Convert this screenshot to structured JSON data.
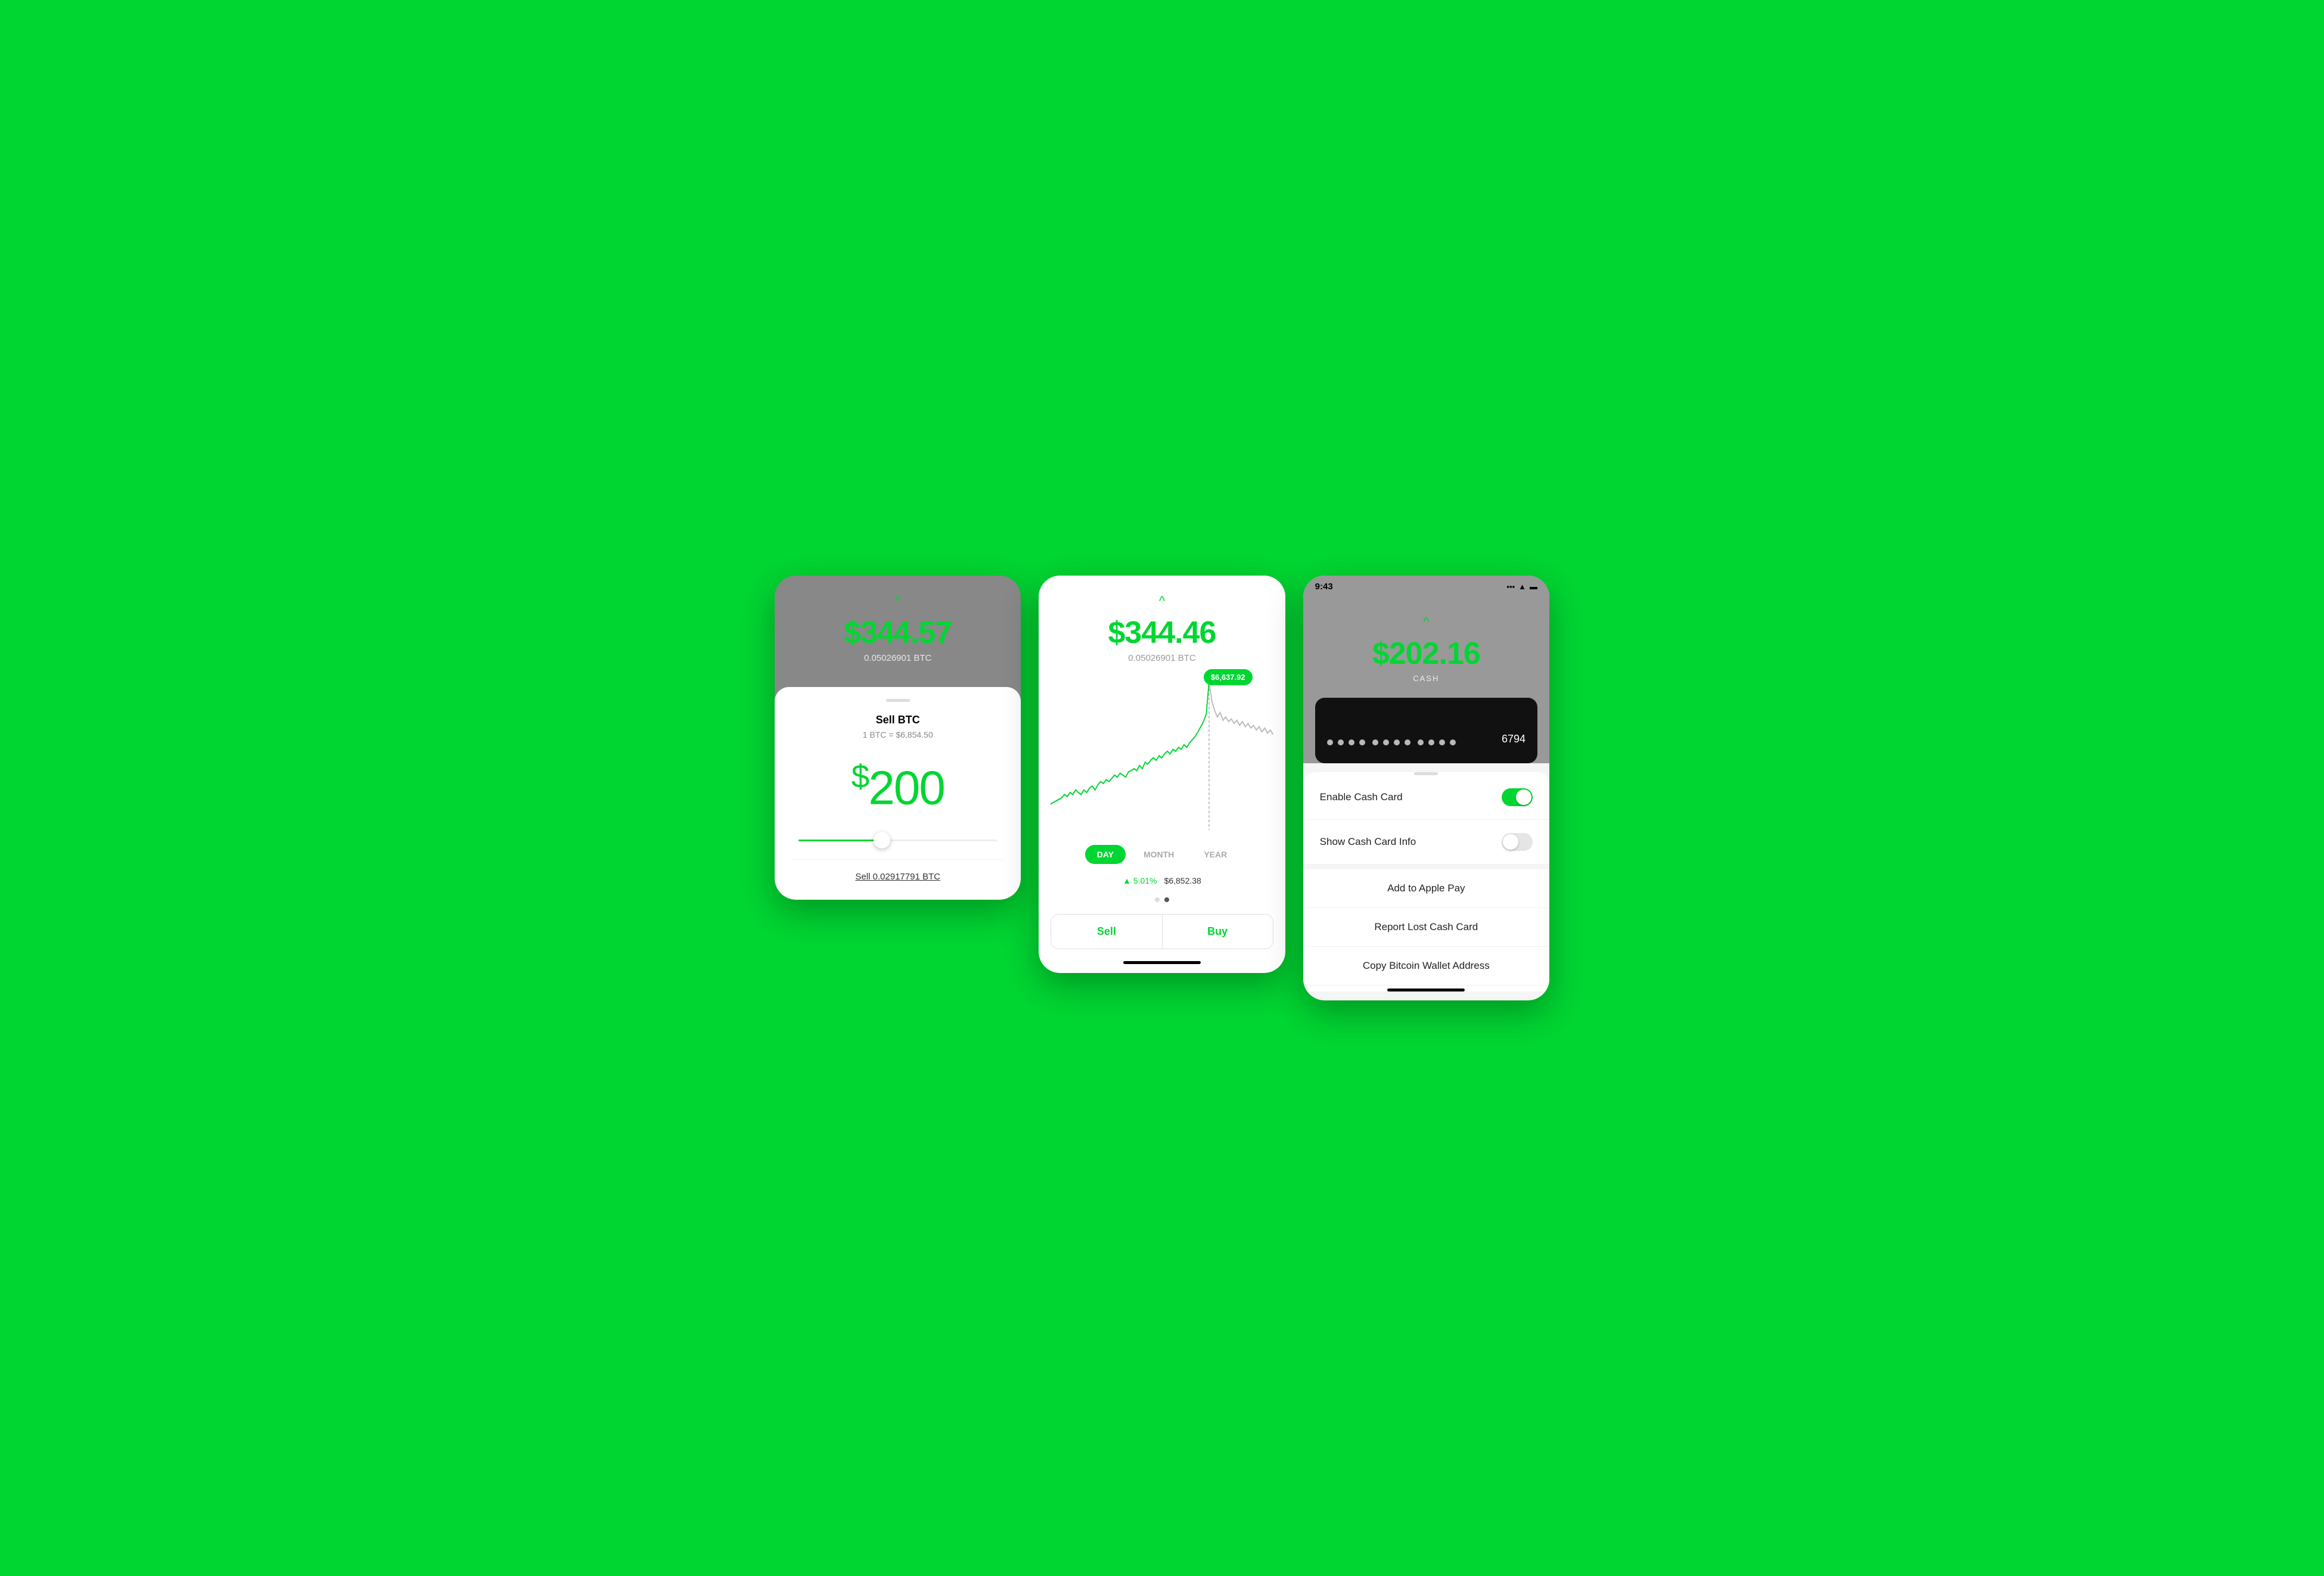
{
  "screen1": {
    "chevron": "^",
    "btc_value": "$344.57",
    "btc_amount": "0.05026901 BTC",
    "handle": "",
    "sell_title": "Sell BTC",
    "sell_rate": "1 BTC = $6,854.50",
    "sell_amount_symbol": "$",
    "sell_amount_value": "200",
    "slider_fill_pct": "42",
    "sell_label": "Sell 0.02917791 BTC"
  },
  "screen2": {
    "chevron": "^",
    "btc_value": "$344.46",
    "btc_amount": "0.05026901 BTC",
    "tooltip_value": "$6,637.92",
    "time_tabs": [
      "DAY",
      "MONTH",
      "YEAR"
    ],
    "active_tab": "DAY",
    "stat_change": "▲ 5.01%",
    "stat_price": "$6,852.38",
    "sell_btn": "Sell",
    "buy_btn": "Buy"
  },
  "screen3": {
    "status_time": "9:43",
    "status_arrow": "✈",
    "chevron": "^",
    "cash_value": "$202.16",
    "cash_label": "CASH",
    "card_last4": "6794",
    "settings": {
      "enable_label": "Enable Cash Card",
      "enable_on": true,
      "show_info_label": "Show Cash Card Info",
      "show_info_on": false,
      "apple_pay_label": "Add to Apple Pay",
      "report_lost_label": "Report Lost Cash Card",
      "copy_wallet_label": "Copy Bitcoin Wallet Address"
    }
  }
}
